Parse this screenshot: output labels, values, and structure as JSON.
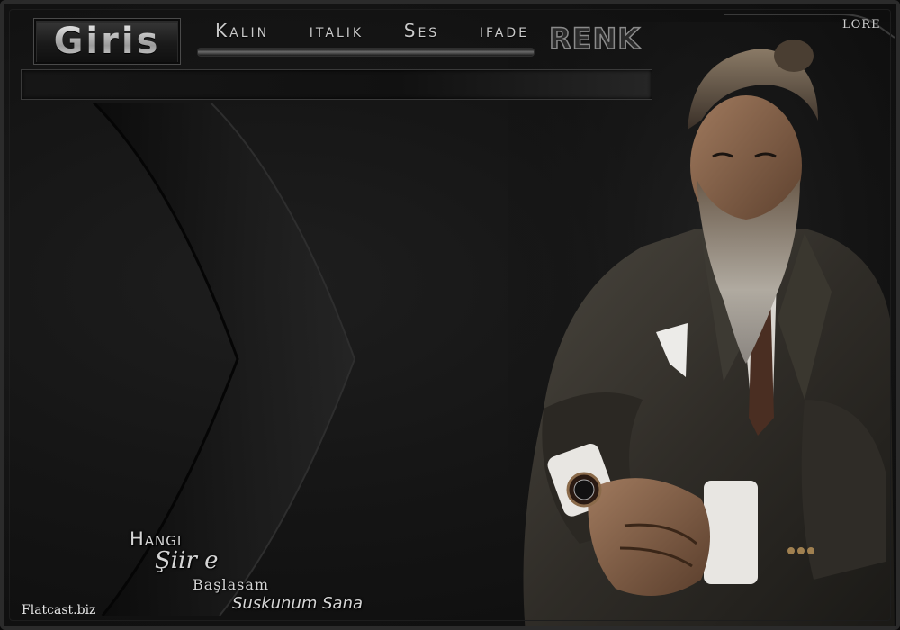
{
  "header": {
    "login_label": "Giris",
    "toolbar_items": [
      "Kalın",
      "italik",
      "Ses",
      "ifade"
    ],
    "color_label": "RENK",
    "brand": "LORE"
  },
  "message_bar": {
    "value": ""
  },
  "poem": {
    "lines": [
      "Hangi",
      "Şiir e",
      "Başlasam",
      "Suskunum Sana"
    ]
  },
  "footer": {
    "site_link": "Flatcast.biz"
  },
  "colors": {
    "background": "#151515",
    "text": "#d5d5d5",
    "frame": "#2b2b2b"
  }
}
